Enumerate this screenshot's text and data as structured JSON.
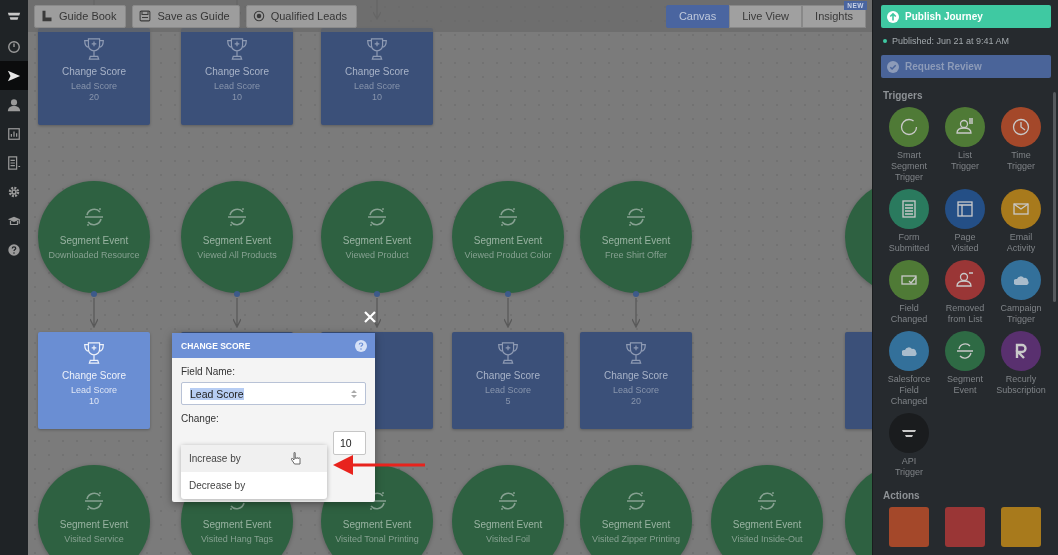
{
  "nav": [
    {
      "kind": "logo",
      "selected": false
    },
    {
      "kind": "gauge",
      "selected": false
    },
    {
      "kind": "send",
      "selected": true
    },
    {
      "kind": "person",
      "selected": false
    },
    {
      "kind": "chart",
      "selected": false
    },
    {
      "kind": "list",
      "selected": false
    },
    {
      "kind": "gear",
      "selected": false
    },
    {
      "kind": "cap",
      "selected": false
    },
    {
      "kind": "help",
      "selected": false
    }
  ],
  "toolbar": {
    "buttons": [
      {
        "kind": "book",
        "label": "Guide Book"
      },
      {
        "kind": "save",
        "label": "Save as Guide"
      },
      {
        "kind": "target",
        "label": "Qualified Leads"
      }
    ],
    "views": [
      {
        "label": "Canvas",
        "selected": true
      },
      {
        "label": "Live View",
        "selected": false
      },
      {
        "label": "Insights",
        "selected": false,
        "badge": "NEW"
      }
    ]
  },
  "canvas": {
    "rows": [
      {
        "kind": "score",
        "nodes": [
          {
            "title": "Change Score",
            "field": "Lead Score",
            "value": "20",
            "selected": false
          },
          {
            "title": "Change Score",
            "field": "Lead Score",
            "value": "10",
            "selected": false
          },
          {
            "title": "Change Score",
            "field": "Lead Score",
            "value": "10",
            "selected": false
          }
        ]
      },
      {
        "kind": "event",
        "more_right": true,
        "nodes": [
          {
            "title": "Segment Event",
            "event": "Downloaded Resource"
          },
          {
            "title": "Segment Event",
            "event": "Viewed All Products"
          },
          {
            "title": "Segment Event",
            "event": "Viewed Product"
          },
          {
            "title": "Segment Event",
            "event": "Viewed Product Color"
          },
          {
            "title": "Segment Event",
            "event": "Free Shirt Offer"
          }
        ]
      },
      {
        "kind": "score",
        "more_right": true,
        "nodes": [
          {
            "title": "Change Score",
            "field": "Lead Score",
            "value": "10",
            "selected": true
          },
          {
            "selected": false
          },
          {
            "selected": false
          },
          {
            "title": "Change Score",
            "field": "Lead Score",
            "value": "5",
            "selected": false
          },
          {
            "title": "Change Score",
            "field": "Lead Score",
            "value": "20",
            "selected": false
          }
        ]
      },
      {
        "kind": "event",
        "more_right": true,
        "nodes": [
          {
            "title": "Segment Event",
            "event": "Visited Service"
          },
          {
            "title": "Segment Event",
            "event": "Visited Hang Tags"
          },
          {
            "title": "Segment Event",
            "event": "Visited Tonal Printing"
          },
          {
            "title": "Segment Event",
            "event": "Visited Foil"
          },
          {
            "title": "Segment Event",
            "event": "Visited Zipper Printing"
          },
          {
            "title": "Segment Event",
            "event": "Visited Inside-Out"
          }
        ]
      }
    ]
  },
  "dialog": {
    "title": "CHANGE SCORE",
    "field_label": "Field Name:",
    "field_value": "Lead Score",
    "change_label": "Change:",
    "options": [
      {
        "label": "Increase by",
        "hovered": true
      },
      {
        "label": "Decrease by",
        "hovered": false
      }
    ],
    "amount": "10"
  },
  "panel": {
    "publish_button": "Publish Journey",
    "status": "Published: Jun 21 at 9:41 AM",
    "review_button": "Request Review",
    "sections": [
      {
        "title": "Triggers",
        "items": [
          {
            "kind": "ring",
            "label": "Smart Segment Trigger",
            "color": "#4f7a36"
          },
          {
            "kind": "person-list",
            "label": "List Trigger",
            "color": "#4f7a36"
          },
          {
            "kind": "clock",
            "label": "Time Trigger",
            "color": "#a4482a"
          },
          {
            "kind": "form",
            "label": "Form Submitted",
            "color": "#2a7a5e"
          },
          {
            "kind": "page",
            "label": "Page Visited",
            "color": "#244f86"
          },
          {
            "kind": "mail",
            "label": "Email Activity",
            "color": "#a87a1c"
          },
          {
            "kind": "check-field",
            "label": "Field Changed",
            "color": "#4f7a36"
          },
          {
            "kind": "person-minus",
            "label": "Removed from List",
            "color": "#9a3636"
          },
          {
            "kind": "cloud",
            "label": "Campaign Trigger",
            "color": "#33709a"
          },
          {
            "kind": "cloud",
            "label": "Salesforce Field Changed",
            "color": "#33709a"
          },
          {
            "kind": "segment",
            "label": "Segment Event",
            "color": "#2e6a44"
          },
          {
            "kind": "letter-r",
            "label": "Recurly Subscription",
            "color": "#59306f"
          },
          {
            "kind": "stack",
            "label": "API Trigger",
            "color": "#1a1c1e"
          }
        ]
      },
      {
        "title": "Actions",
        "items": [
          {
            "kind": "square",
            "color": "#a4482a"
          },
          {
            "kind": "square",
            "color": "#9a3636"
          },
          {
            "kind": "square",
            "color": "#a87a1c"
          }
        ]
      }
    ]
  }
}
